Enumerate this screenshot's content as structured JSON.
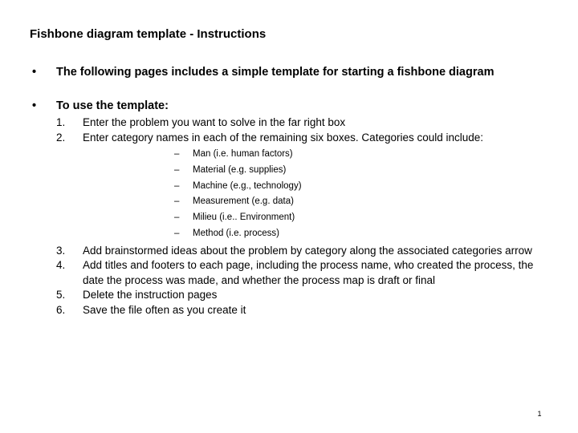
{
  "slide": {
    "title": "Fishbone diagram template - Instructions",
    "page_number": "1",
    "bullet_marker": "•",
    "dash_marker": "–",
    "background_color": "#ffffff",
    "text_color": "#000000"
  },
  "bullets": [
    {
      "marker": "•",
      "text": "The following pages includes a simple template for starting a fishbone diagram"
    },
    {
      "marker": "•",
      "text": "To use the template:"
    }
  ],
  "steps": [
    {
      "num": "1.",
      "text": "Enter the problem you want to solve in the far right box"
    },
    {
      "num": "2.",
      "text": "Enter category names in each of the remaining six boxes. Categories could include:"
    },
    {
      "num": "3.",
      "text": "Add brainstormed ideas about the problem by category along the associated categories arrow"
    },
    {
      "num": "4.",
      "text": "Add titles and footers to each page, including the process name, who created the process, the date the process was made, and whether the process map is draft or final"
    },
    {
      "num": "5.",
      "text": "Delete the instruction pages"
    },
    {
      "num": "6.",
      "text": "Save the file often as you create it"
    }
  ],
  "categories": [
    {
      "marker": "–",
      "text": "Man (i.e. human factors)"
    },
    {
      "marker": "–",
      "text": "Material (e.g. supplies)"
    },
    {
      "marker": "–",
      "text": "Machine (e.g., technology)"
    },
    {
      "marker": "–",
      "text": "Measurement (e.g. data)"
    },
    {
      "marker": "–",
      "text": "Milieu (i.e.. Environment)"
    },
    {
      "marker": "–",
      "text": "Method (i.e. process)"
    }
  ]
}
